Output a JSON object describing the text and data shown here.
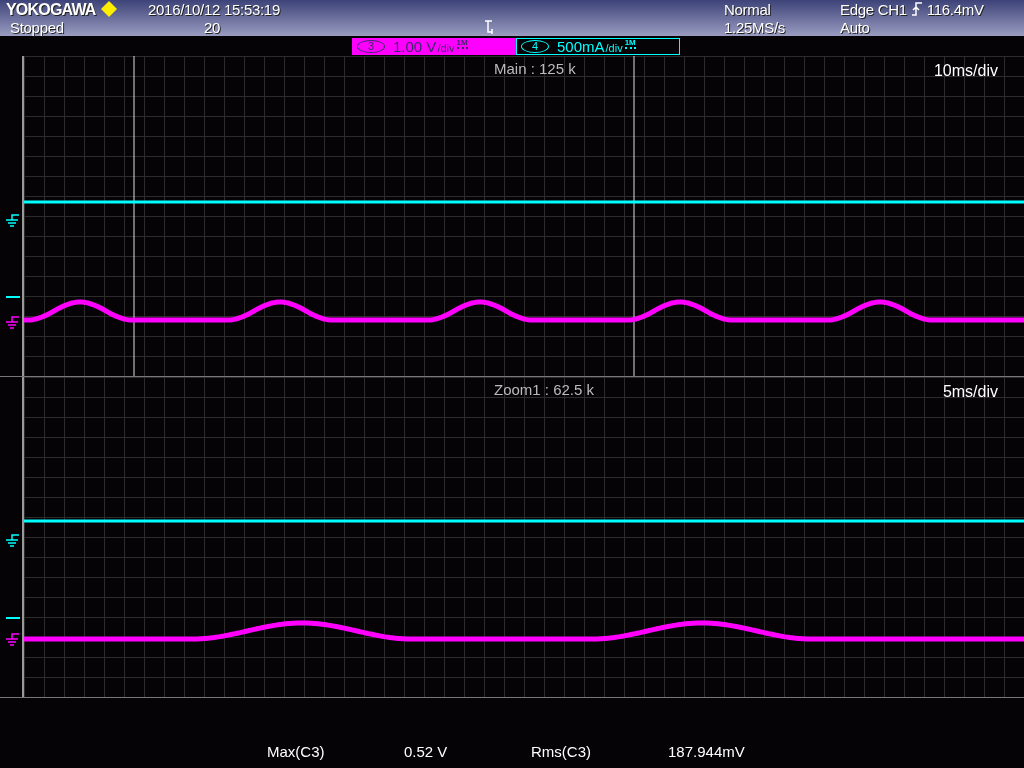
{
  "header": {
    "brand": "YOKOGAWA",
    "datetime": "2016/10/12 15:53:19",
    "status": "Stopped",
    "record_count": "20",
    "acquisition_mode": "Normal",
    "sample_rate": "1.25MS/s",
    "trigger": {
      "source": "Edge CH1",
      "level": "116.4mV",
      "mode": "Auto"
    }
  },
  "channels": [
    {
      "number": "3",
      "scale": "1.00 V",
      "per_div": "/div",
      "input": "1M",
      "color": "#ff00ff",
      "selected": true
    },
    {
      "number": "4",
      "scale": "500mA",
      "per_div": "/div",
      "input": "1M",
      "color": "#00ffff",
      "selected": false
    }
  ],
  "panels": [
    {
      "kind": "main",
      "label": "Main : 125 k",
      "timebase": "10ms/div"
    },
    {
      "kind": "zoom",
      "label": "Zoom1 : 62.5 k",
      "timebase": "5ms/div"
    }
  ],
  "measurements": [
    {
      "name": "Max(C3)",
      "value": "0.52 V"
    },
    {
      "name": "Rms(C3)",
      "value": "187.944mV"
    }
  ]
}
